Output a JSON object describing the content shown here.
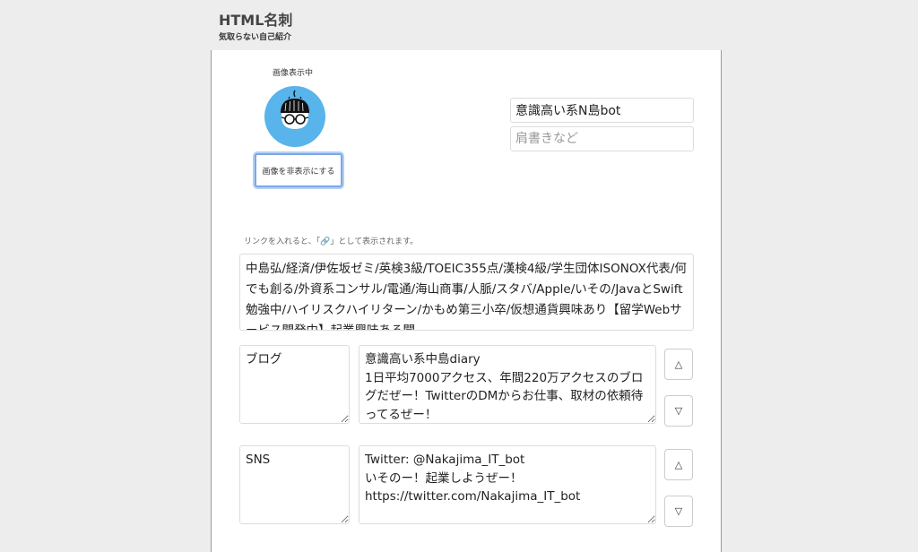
{
  "header": {
    "title": "HTML名刺",
    "subtitle": "気取らない自己紹介"
  },
  "profile": {
    "image_caption": "画像表示中",
    "toggle_image_label": "画像を非表示にする",
    "avatar_color": "#58b4ea",
    "name_value": "意識高い系N島bot",
    "title_placeholder": "肩書きなど"
  },
  "bio": {
    "hint": "リンクを入れると、「🔗」として表示されます。",
    "text": "中島弘/経済/伊佐坂ゼミ/英検3級/TOEIC355点/漢検4級/学生団体ISONOX代表/何でも創る/外資系コンサル/電通/海山商事/人脈/スタバ/Apple/いその/JavaとSwift勉強中/ハイリスクハイリターン/かもめ第三小卒/仮想通貨興味あり【留学Webサービス開発中】起業興味ある聞"
  },
  "links": [
    {
      "label": "ブログ",
      "description": "意識高い系中島diary\n1日平均7000アクセス、年間220万アクセスのブログだぜー！TwitterのDMからお仕事、取材の依頼待ってるぜー！",
      "up_icon": "△",
      "down_icon": "▽"
    },
    {
      "label": "SNS",
      "description": "Twitter: @Nakajima_IT_bot\nいそのー！起業しようぜー！\nhttps://twitter.com/Nakajima_IT_bot",
      "up_icon": "△",
      "down_icon": "▽"
    }
  ]
}
